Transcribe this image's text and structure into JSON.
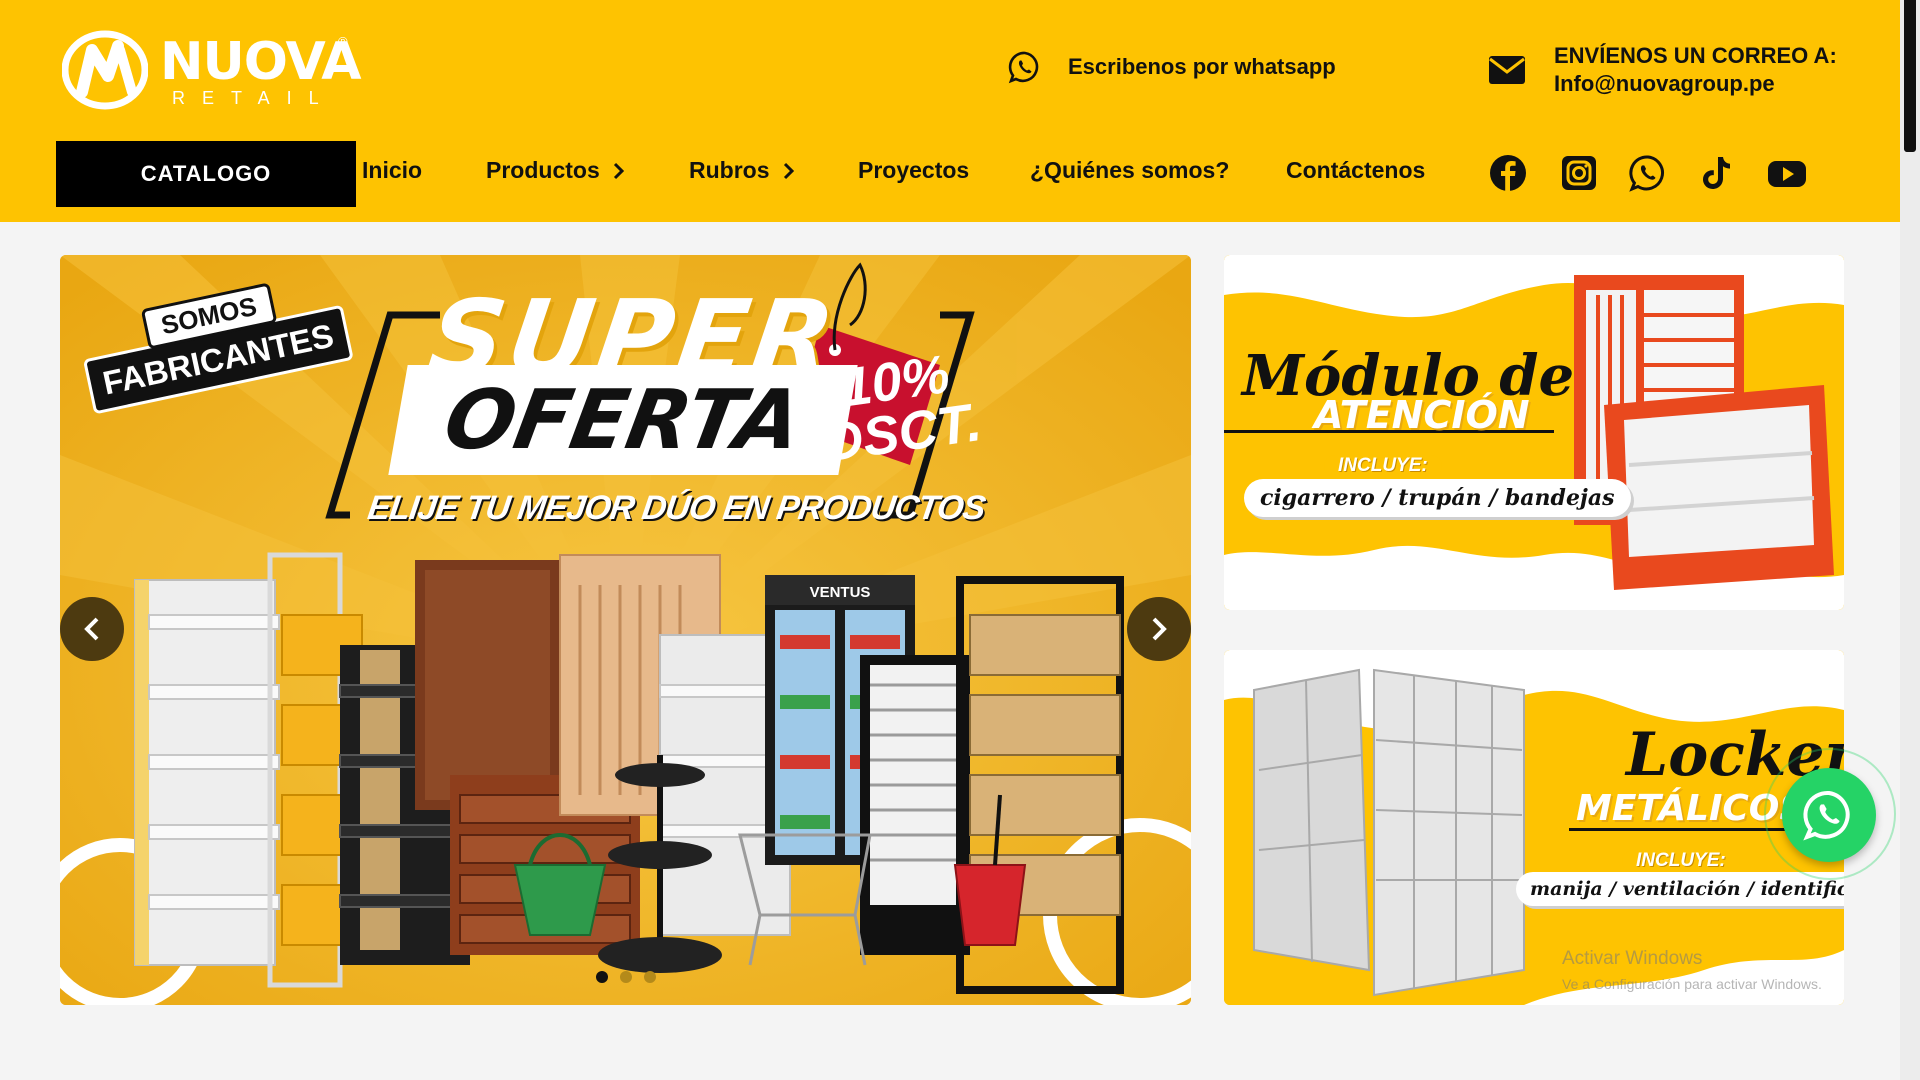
{
  "brand": {
    "name": "NUOVA",
    "registered": "®",
    "tagline": "RETAIL",
    "logo_icon": "nuova-n-mark"
  },
  "header": {
    "whatsapp_text": "Escribenos por whatsapp",
    "email_label": "ENVÍENOS UN CORREO A:",
    "email_address": "Info@nuovagroup.pe",
    "background": "#fec301"
  },
  "nav": {
    "catalog_label": "CATALOGO",
    "items": [
      {
        "label": "Inicio",
        "has_dropdown": false
      },
      {
        "label": "Productos",
        "has_dropdown": true
      },
      {
        "label": "Rubros",
        "has_dropdown": true
      },
      {
        "label": "Proyectos",
        "has_dropdown": false
      },
      {
        "label": "¿Quiénes somos?",
        "has_dropdown": false
      },
      {
        "label": "Contáctenos",
        "has_dropdown": false
      }
    ],
    "social_icons": [
      "facebook-icon",
      "instagram-icon",
      "whatsapp-icon",
      "tiktok-icon",
      "youtube-icon"
    ]
  },
  "hero": {
    "badge_top": "SOMOS",
    "badge_bottom": "FABRICANTES",
    "headline_1": "SUPER",
    "headline_2": "OFERTA",
    "discount": "10%",
    "discount_label": "DSCT.",
    "subheadline": "ELIJE TU MEJOR DÚO EN PRODUCTOS",
    "fridge_brand": "VENTUS",
    "slide_count": 3,
    "active_slide": 1
  },
  "banner_1": {
    "title_script": "Módulo de",
    "title_caps": "ATENCIÓN",
    "incluye": "INCLUYE:",
    "items_text": "cigarrero  /  trupán  /  bandejas"
  },
  "banner_2": {
    "title_script": "Lockers",
    "title_caps": "METÁLICOS",
    "incluye": "INCLUYE:",
    "items_text": "manija / ventilación /  identificador"
  },
  "watermark": {
    "line_1": "Activar Windows",
    "line_2": "Ve a Configuración para activar Windows."
  },
  "colors": {
    "accent": "#fec301",
    "dark": "#111111",
    "whatsapp": "#25d366",
    "tag_red": "#c8102e"
  }
}
